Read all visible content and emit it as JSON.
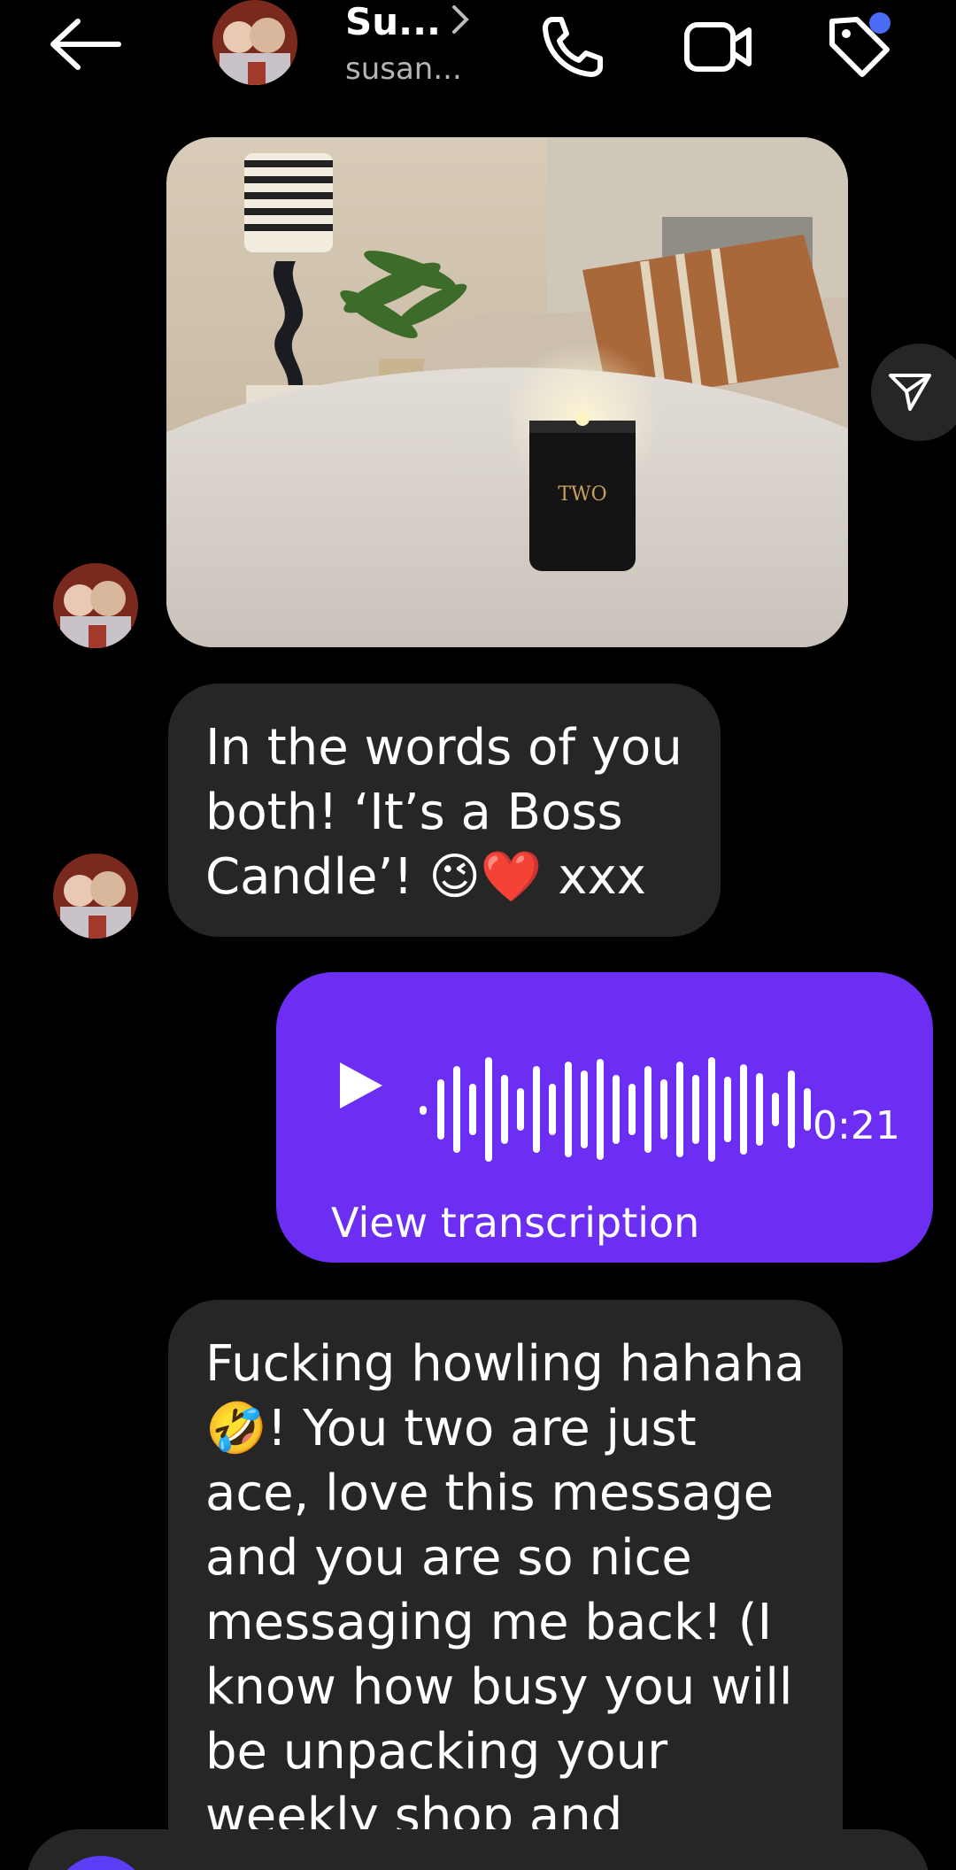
{
  "header": {
    "name": "Su...",
    "username": "susan...",
    "back_icon": "arrow-left-icon",
    "call_icon": "phone-icon",
    "video_icon": "video-camera-icon",
    "tag_icon": "tag-icon",
    "chevron_icon": "chevron-right-icon"
  },
  "messages": [
    {
      "type": "image",
      "from": "other",
      "description_icon": "photo"
    },
    {
      "type": "text",
      "from": "other",
      "lines": [
        "In the words of you",
        "both! ‘It’s a Boss",
        "Candle’!  😉❤️ xxx"
      ]
    },
    {
      "type": "voice",
      "from": "me",
      "duration": "0:21",
      "action": "View transcription"
    },
    {
      "type": "text",
      "from": "other",
      "lines": [
        "Fucking howling hahaha",
        "🤣! You two are just",
        "ace, love this message",
        "and you are so nice",
        "messaging me back! (I",
        "know how busy you will",
        "be unpacking your",
        "weekly shop and"
      ]
    }
  ],
  "colors": {
    "background": "#000000",
    "incoming_bubble": "#262626",
    "outgoing_bubble": "#6c2ef2",
    "notification_dot": "#4a6cf7"
  }
}
